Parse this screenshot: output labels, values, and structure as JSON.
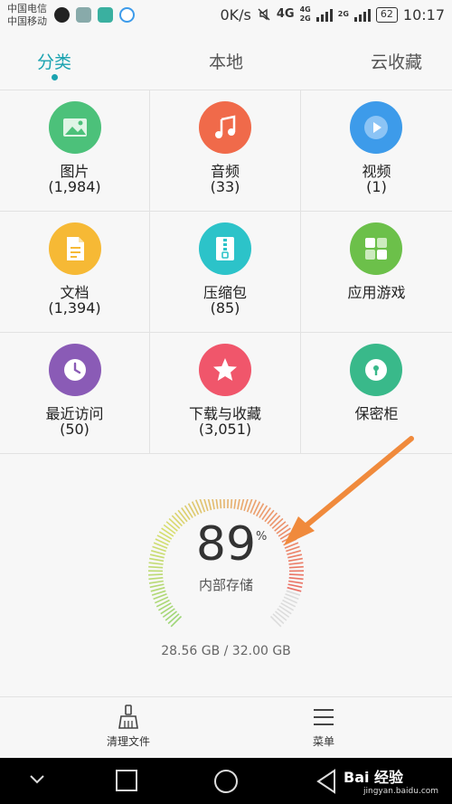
{
  "status_bar": {
    "carrier_1": "中国电信",
    "carrier_2": "中国移动",
    "speed": "0K/s",
    "net_4g": "4G",
    "net_4g_small": "4G",
    "net_2g_small": "2G",
    "net_2g": "2G",
    "battery": "62",
    "time": "10:17"
  },
  "tabs": [
    {
      "label": "分类",
      "active": true
    },
    {
      "label": "本地",
      "active": false
    },
    {
      "label": "云收藏",
      "active": false
    }
  ],
  "categories": [
    {
      "label": "图片",
      "count": "(1,984)",
      "icon": "image-icon",
      "color": "#4cc17a"
    },
    {
      "label": "音频",
      "count": "(33)",
      "icon": "music-icon",
      "color": "#f06a4a"
    },
    {
      "label": "视频",
      "count": "(1)",
      "icon": "video-icon",
      "color": "#3d9bea"
    },
    {
      "label": "文档",
      "count": "(1,394)",
      "icon": "document-icon",
      "color": "#f6b935"
    },
    {
      "label": "压缩包",
      "count": "(85)",
      "icon": "archive-icon",
      "color": "#2cc3c9"
    },
    {
      "label": "应用游戏",
      "count": "",
      "icon": "apps-icon",
      "color": "#6cc04a"
    },
    {
      "label": "最近访问",
      "count": "(50)",
      "icon": "clock-icon",
      "color": "#8a5bb6"
    },
    {
      "label": "下载与收藏",
      "count": "(3,051)",
      "icon": "star-icon",
      "color": "#f0566b"
    },
    {
      "label": "保密柜",
      "count": "",
      "icon": "lock-icon",
      "color": "#39b98a"
    }
  ],
  "storage": {
    "percent": "89",
    "percent_sign": "%",
    "label": "内部存储",
    "usage": "28.56 GB / 32.00 GB",
    "used_fraction": 0.8925
  },
  "bottom_bar": {
    "clean_label": "清理文件",
    "menu_label": "菜单"
  },
  "watermark": {
    "text": "Bai 经验",
    "url": "jingyan.baidu.com"
  },
  "colors": {
    "accent": "#1aa3b0",
    "arrow": "#f08a3c"
  }
}
